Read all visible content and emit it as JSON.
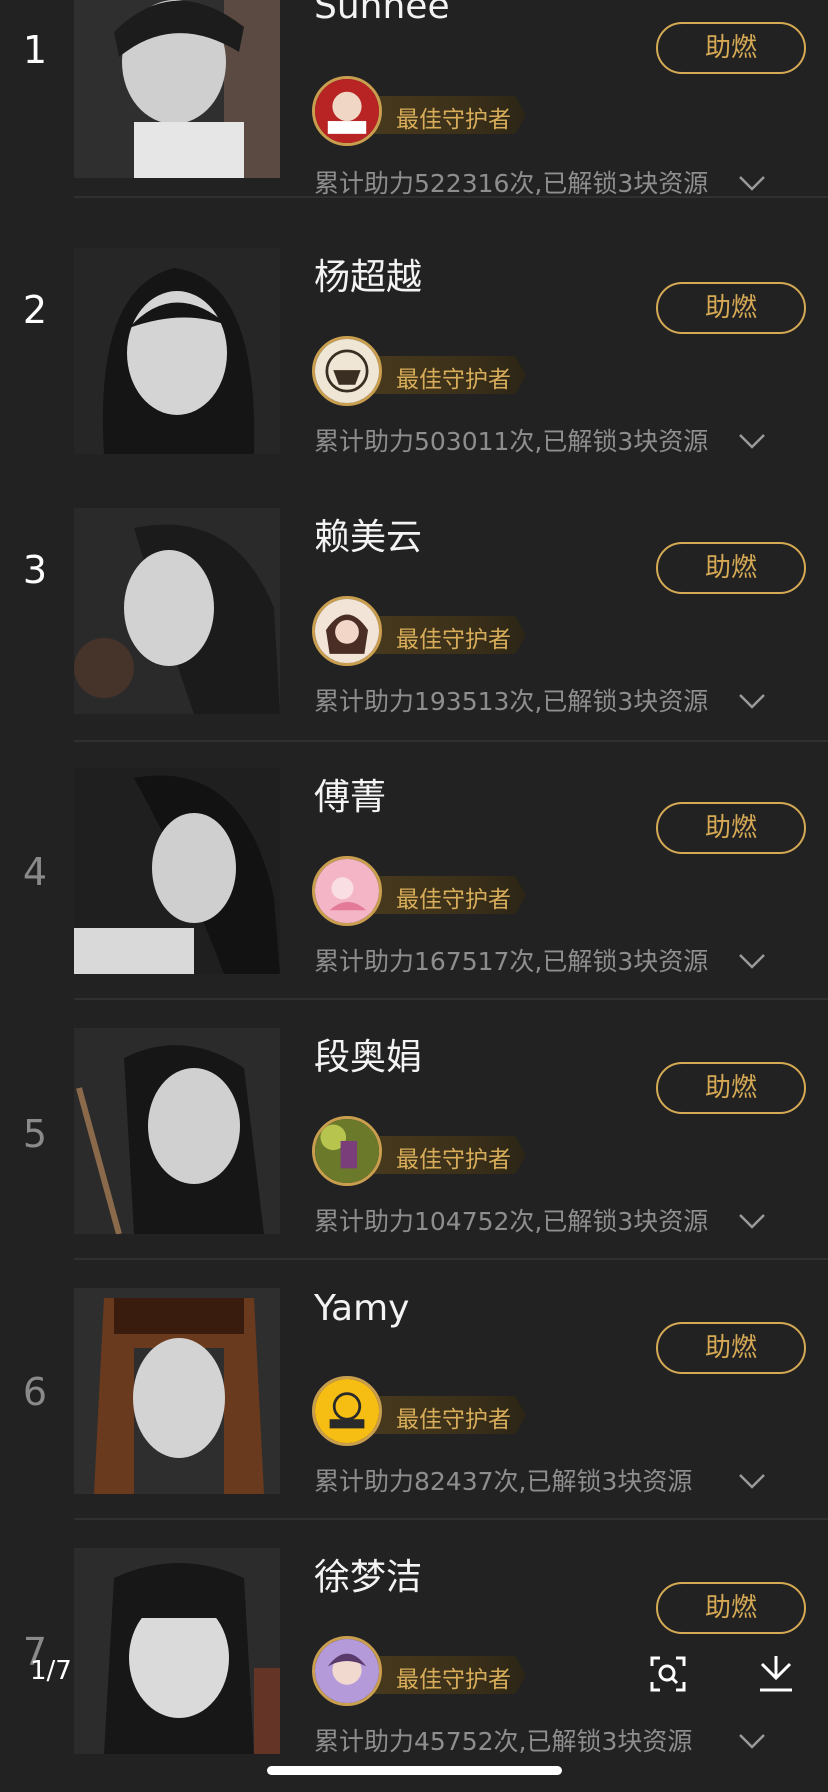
{
  "guardian_label": "最佳守护者",
  "boost_label": "助燃",
  "pager": "1/7",
  "icons": {
    "search_image": "image-search-icon",
    "download": "download-icon",
    "expand": "chevron-down-icon"
  },
  "colors": {
    "background": "#222222",
    "accent": "#d6aa55",
    "muted_text": "#8e8e8e"
  },
  "ranking": [
    {
      "rank": "1",
      "name": "Sunnee",
      "stats": "累计助力522316次,已解锁3块资源"
    },
    {
      "rank": "2",
      "name": "杨超越",
      "stats": "累计助力503011次,已解锁3块资源"
    },
    {
      "rank": "3",
      "name": "赖美云",
      "stats": "累计助力193513次,已解锁3块资源"
    },
    {
      "rank": "4",
      "name": "傅菁",
      "stats": "累计助力167517次,已解锁3块资源"
    },
    {
      "rank": "5",
      "name": "段奥娟",
      "stats": "累计助力104752次,已解锁3块资源"
    },
    {
      "rank": "6",
      "name": "Yamy",
      "stats": "累计助力82437次,已解锁3块资源"
    },
    {
      "rank": "7",
      "name": "徐梦洁",
      "stats": "累计助力45752次,已解锁3块资源"
    }
  ]
}
